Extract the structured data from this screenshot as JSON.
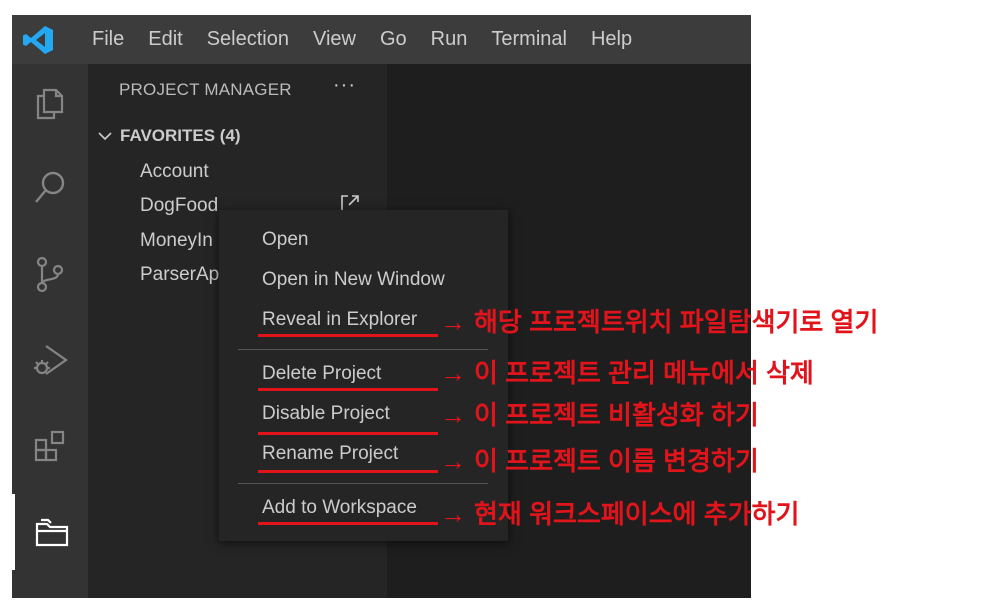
{
  "menubar": [
    "File",
    "Edit",
    "Selection",
    "View",
    "Go",
    "Run",
    "Terminal",
    "Help"
  ],
  "activity_icons": [
    "explorer-icon",
    "search-icon",
    "source-control-icon",
    "run-debug-icon",
    "extensions-icon",
    "project-manager-icon"
  ],
  "sidebar": {
    "title": "PROJECT MANAGER",
    "more": "···",
    "favorites_label": "FAVORITES (4)",
    "projects": [
      "Account",
      "DogFood",
      "MoneyIn",
      "ParserAp"
    ]
  },
  "context_menu": {
    "open": "Open",
    "open_new_window": "Open in New Window",
    "reveal": "Reveal in Explorer",
    "delete": "Delete Project",
    "disable": "Disable Project",
    "rename": "Rename Project",
    "add_workspace": "Add to Workspace"
  },
  "annotations": {
    "arrow": "→",
    "reveal": "해당 프로젝트위치 파일탐색기로 열기",
    "delete": "이 프로젝트 관리 메뉴에서 삭제",
    "disable": "이 프로젝트 비활성화 하기",
    "rename": "이 프로젝트 이름 변경하기",
    "add_workspace": "현재 워크스페이스에 추가하기"
  },
  "colors": {
    "accent_red": "#e0141a",
    "vscode_blue": "#23a9f2"
  }
}
